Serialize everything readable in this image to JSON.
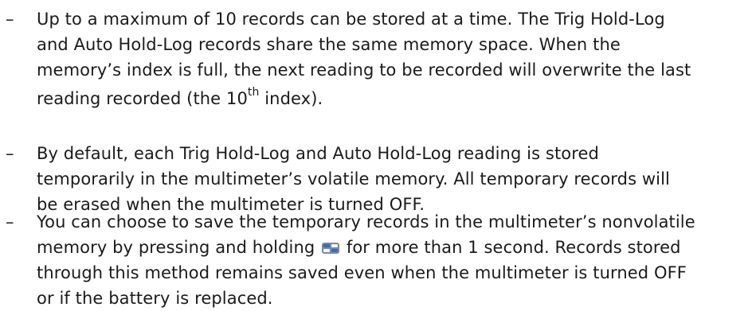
{
  "bullets": [
    {
      "dash": "–",
      "lines": [
        "Up to a maximum of 10 records can be stored at a time. The Trig Hold-Log",
        "and Auto Hold-Log records share the same memory space. When the",
        "memory’s index is full, the next reading to be recorded will overwrite the last"
      ],
      "last_prefix": "reading recorded (the 10",
      "last_sup": "th",
      "last_suffix": " index)."
    },
    {
      "dash": "–",
      "lines": [
        "By default, each Trig Hold-Log and Auto Hold-Log reading is stored",
        "temporarily in the multimeter’s volatile memory. All temporary records will",
        "be erased when the multimeter is turned OFF."
      ]
    },
    {
      "dash": "–",
      "line1": "You can choose to save the temporary records in the multimeter’s nonvolatile",
      "line2_before": "memory by pressing and holding",
      "key_icon_name": "trig-hold-auto-log-key-icon",
      "key_icon_text": "Trig Hold Auto Log",
      "line2_after": "for more than 1 second. Records stored",
      "line3": "through this method remains saved even when the multimeter is turned OFF",
      "line4": "or if the battery is replaced."
    }
  ],
  "colors": {
    "text": "#1a1a1a",
    "key_body": "#7d8a97",
    "key_blue": "#2e6fbf",
    "key_light": "#f3f6fa"
  }
}
